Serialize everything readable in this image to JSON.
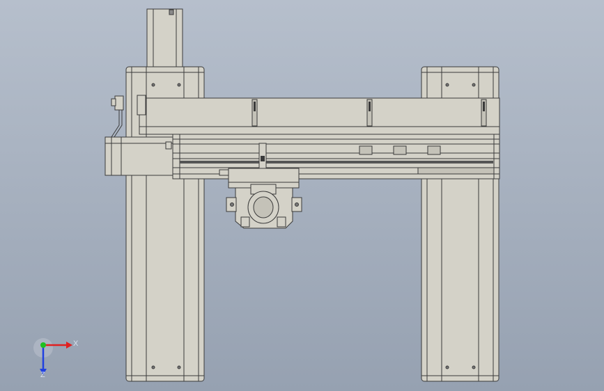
{
  "viewport": {
    "background_top": "#b6bfcc",
    "background_bottom": "#96a1b1"
  },
  "model": {
    "part_fill": "#d4d2c8",
    "part_fill_dark": "#c4c2b8",
    "edge_color": "#3a3a3a",
    "accent_color": "#555555"
  },
  "triad": {
    "x_label": "X",
    "z_label": "Z",
    "x_color": "#e02020",
    "y_color": "#20c020",
    "z_color": "#2040e0"
  }
}
